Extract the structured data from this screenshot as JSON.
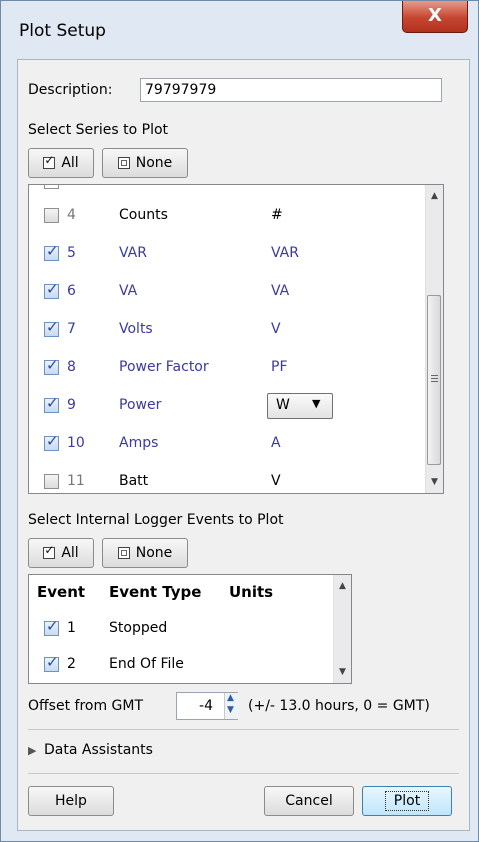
{
  "window": {
    "title": "Plot Setup",
    "close_glyph": "X"
  },
  "description": {
    "label": "Description:",
    "value": "79797979"
  },
  "series_section": {
    "heading": "Select Series to Plot",
    "all_label": "All",
    "none_label": "None",
    "rows": [
      {
        "number": "4",
        "name": "Counts",
        "unit": "#",
        "checked": false
      },
      {
        "number": "5",
        "name": "VAR",
        "unit": "VAR",
        "checked": true
      },
      {
        "number": "6",
        "name": "VA",
        "unit": "VA",
        "checked": true
      },
      {
        "number": "7",
        "name": "Volts",
        "unit": "V",
        "checked": true
      },
      {
        "number": "8",
        "name": "Power Factor",
        "unit": "PF",
        "checked": true
      },
      {
        "number": "9",
        "name": "Power",
        "unit": "W",
        "checked": true
      },
      {
        "number": "10",
        "name": "Amps",
        "unit": "A",
        "checked": true
      },
      {
        "number": "11",
        "name": "Batt",
        "unit": "V",
        "checked": false
      }
    ]
  },
  "events_section": {
    "heading": "Select Internal Logger Events to Plot",
    "all_label": "All",
    "none_label": "None",
    "columns": [
      "Event",
      "Event Type",
      "Units"
    ],
    "rows": [
      {
        "number": "1",
        "type": "Stopped",
        "checked": true
      },
      {
        "number": "2",
        "type": "End Of File",
        "checked": true
      }
    ]
  },
  "offset": {
    "label": "Offset from GMT",
    "value": "-4",
    "hint": "(+/- 13.0 hours, 0 = GMT)"
  },
  "data_assistants": {
    "label": "Data Assistants"
  },
  "footer": {
    "help_label": "Help",
    "cancel_label": "Cancel",
    "plot_label": "Plot"
  },
  "colors": {
    "titlebar": "#dfe8f3",
    "close": "#c44530",
    "active_text": "#3a3aa0"
  }
}
